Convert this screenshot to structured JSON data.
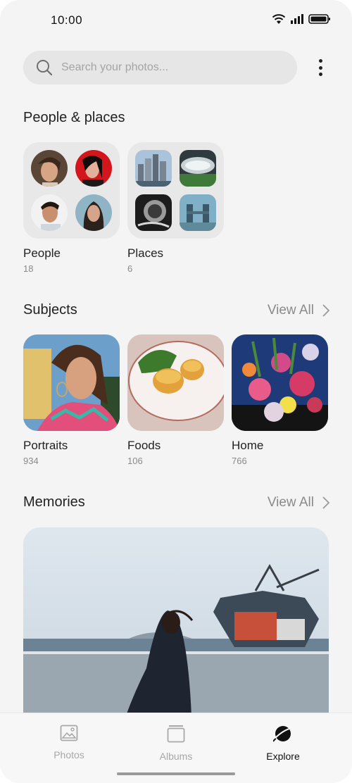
{
  "status": {
    "time": "10:00",
    "icons": [
      "wifi-icon",
      "signal-icon",
      "battery-icon"
    ]
  },
  "search": {
    "placeholder": "Search your photos..."
  },
  "people_places": {
    "title": "People & places",
    "people": {
      "label": "People",
      "count": "18"
    },
    "places": {
      "label": "Places",
      "count": "6"
    }
  },
  "subjects": {
    "title": "Subjects",
    "view_all": "View All",
    "items": [
      {
        "label": "Portraits",
        "count": "934"
      },
      {
        "label": "Foods",
        "count": "106"
      },
      {
        "label": "Home",
        "count": "766"
      }
    ]
  },
  "memories": {
    "title": "Memories",
    "view_all": "View All"
  },
  "nav": {
    "items": [
      {
        "label": "Photos",
        "icon": "photo-icon",
        "active": false
      },
      {
        "label": "Albums",
        "icon": "albums-icon",
        "active": false
      },
      {
        "label": "Explore",
        "icon": "explore-planet-icon",
        "active": true
      }
    ]
  },
  "colors": {
    "background": "#f4f4f4",
    "search_bg": "#e6e6e6",
    "tile_bg": "#e8e8e8",
    "muted_text": "#8a8a8a"
  }
}
